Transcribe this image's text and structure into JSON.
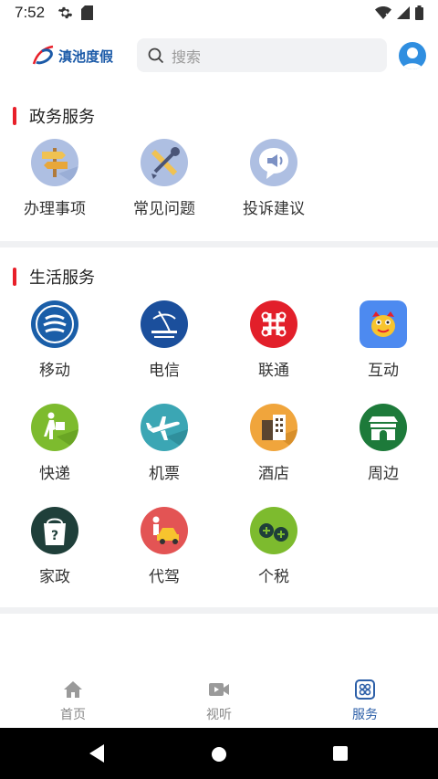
{
  "status_bar": {
    "time": "7:52"
  },
  "header": {
    "logo_text": "滇池度假",
    "search_placeholder": "搜索"
  },
  "gov_section": {
    "title": "政务服务",
    "items": [
      {
        "label": "办理事项",
        "icon": "signpost-icon"
      },
      {
        "label": "常见问题",
        "icon": "tools-icon"
      },
      {
        "label": "投诉建议",
        "icon": "speech-bubble-icon"
      }
    ]
  },
  "life_section": {
    "title": "生活服务",
    "items": [
      {
        "label": "移动",
        "icon": "china-mobile-icon"
      },
      {
        "label": "电信",
        "icon": "china-telecom-icon"
      },
      {
        "label": "联通",
        "icon": "china-unicom-icon"
      },
      {
        "label": "互动",
        "icon": "dragon-icon"
      },
      {
        "label": "快递",
        "icon": "courier-icon"
      },
      {
        "label": "机票",
        "icon": "airplane-icon"
      },
      {
        "label": "酒店",
        "icon": "hotel-icon"
      },
      {
        "label": "周边",
        "icon": "gate-icon"
      },
      {
        "label": "家政",
        "icon": "housekeeping-icon"
      },
      {
        "label": "代驾",
        "icon": "chauffeur-icon"
      },
      {
        "label": "个税",
        "icon": "tax-icon"
      }
    ]
  },
  "bottom_nav": {
    "items": [
      {
        "label": "首页",
        "icon": "home-icon",
        "active": false
      },
      {
        "label": "视听",
        "icon": "video-icon",
        "active": false
      },
      {
        "label": "服务",
        "icon": "services-icon",
        "active": true
      }
    ]
  },
  "colors": {
    "accent": "#e8202a",
    "active_nav": "#2c5fa8",
    "brand": "#1b5aa8"
  }
}
